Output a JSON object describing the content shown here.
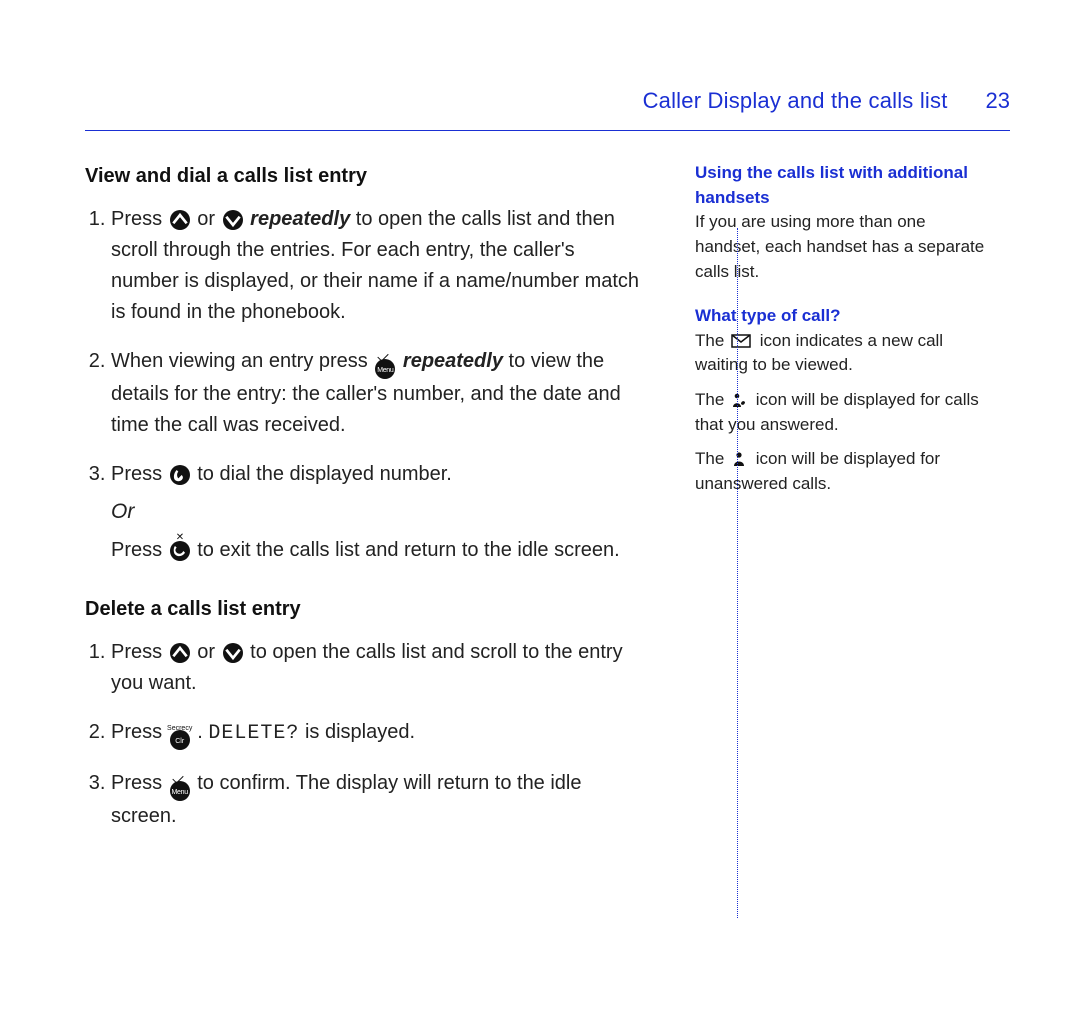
{
  "header": {
    "title": "Caller Display and the calls list",
    "page_number": "23"
  },
  "main": {
    "section1": {
      "heading": "View and dial a calls list entry",
      "step1_a": "Press ",
      "step1_b": " or ",
      "step1_c_ital": "repeatedly",
      "step1_d": " to open the calls list and then scroll through the entries. For each entry, the caller's number is displayed, or their name if a name/number match is found in the phonebook.",
      "step2_a": "When viewing an entry press ",
      "step2_b_ital": "repeatedly",
      "step2_c": " to view the details for the entry: the caller's number, and the date and time the call was received.",
      "step3_a": "Press ",
      "step3_b": " to dial the displayed number.",
      "or": "Or",
      "alt_a": "Press ",
      "alt_b": " to exit the calls list and return to the idle screen."
    },
    "section2": {
      "heading": "Delete a calls list entry",
      "step1_a": "Press ",
      "step1_b": " or ",
      "step1_c": " to open the calls list and scroll to the entry you want.",
      "step2_a": "Press ",
      "step2_b": " . ",
      "step2_code": "DELETE?",
      "step2_c": " is displayed.",
      "step3_a": "Press ",
      "step3_b": " to confirm. The display will return to the idle screen."
    }
  },
  "side": {
    "block1_heading": "Using the calls list with additional handsets",
    "block1_text": "If you are using more than one handset, each handset has a separate calls list.",
    "block2_heading": "What type of call?",
    "block2_a": "The ",
    "block2_b": " icon indicates a new call waiting to be viewed.",
    "block3_a": "The ",
    "block3_b": " icon will be displayed for calls that you answered.",
    "block4_a": "The ",
    "block4_b": " icon will be displayed for unanswered calls."
  }
}
